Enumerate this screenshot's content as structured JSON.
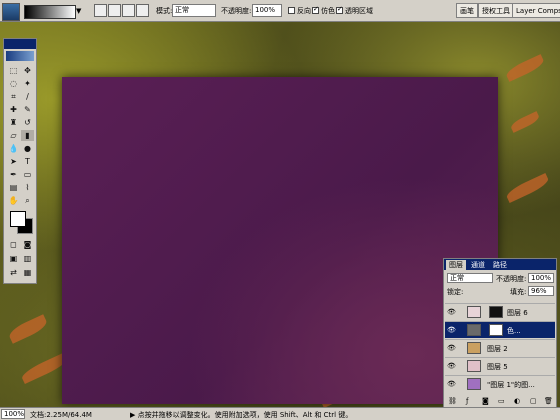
{
  "options_bar": {
    "mode_label": "模式:",
    "mode_value": "正常",
    "opacity_label": "不透明度:",
    "opacity_value": "100%",
    "reverse_label": "反向",
    "dither_label": "仿色",
    "transparency_label": "透明区域",
    "tabs": [
      "画笔",
      "授权工具",
      "Layer Comps"
    ]
  },
  "layers_panel": {
    "tabs": [
      "图层",
      "通道",
      "路径"
    ],
    "blend_mode": "正常",
    "opacity_label": "不透明度:",
    "opacity_value": "100%",
    "lock_label": "锁定:",
    "fill_label": "填充:",
    "fill_value": "96%",
    "layers": [
      {
        "name": "图层 6",
        "selected": false,
        "thumb_color": "#e8d4d8"
      },
      {
        "name": "色...",
        "selected": true,
        "thumb_color": "#6a6a6a"
      },
      {
        "name": "图层 2",
        "selected": false,
        "thumb_color": "#caa060"
      },
      {
        "name": "图层 5",
        "selected": false,
        "thumb_color": "#e0c0c8"
      },
      {
        "name": "\"图层 1\"的图...",
        "selected": false,
        "thumb_color": "#a070c0"
      }
    ]
  },
  "status_bar": {
    "zoom": "100%",
    "doc": "文档:2.25M/64.4M",
    "hint": "▶ 点按并拖移以调整变化。使用附加选项，使用 Shift、Alt 和 Ctrl 键。"
  },
  "colors": {
    "canvas_purple": "#4a1a4a",
    "toolbox_title": "#0a246a"
  }
}
